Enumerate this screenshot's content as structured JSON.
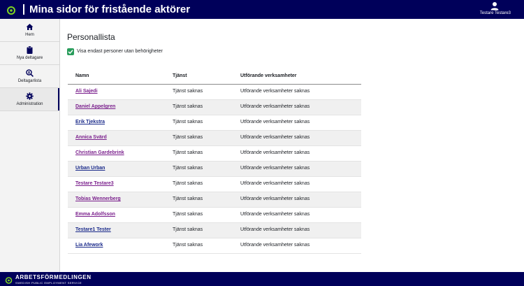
{
  "header": {
    "title": "Mina sidor för fristående aktörer",
    "user_name": "Testare Testare3"
  },
  "sidebar": {
    "items": [
      {
        "label": "Hem",
        "icon": "home-icon"
      },
      {
        "label": "Nya deltagare",
        "icon": "clipboard-icon"
      },
      {
        "label": "Deltagarlista",
        "icon": "search-person-icon"
      },
      {
        "label": "Administration",
        "icon": "gear-icon",
        "active": true
      }
    ]
  },
  "main": {
    "title": "Personallista",
    "filter_checkbox": {
      "label": "Visa endast personer utan behörigheter",
      "checked": true
    },
    "table": {
      "columns": [
        "Namn",
        "Tjänst",
        "Utförande verksamheter"
      ],
      "rows": [
        {
          "name": "Ali Sajedi",
          "service": "Tjänst saknas",
          "operations": "Utförande verksamheter saknas"
        },
        {
          "name": "Daniel Appelgren",
          "service": "Tjänst saknas",
          "operations": "Utförande verksamheter saknas"
        },
        {
          "name": "Erik Tjekstra",
          "service": "Tjänst saknas",
          "operations": "Utförande verksamheter saknas"
        },
        {
          "name": "Annica Svärd",
          "service": "Tjänst saknas",
          "operations": "Utförande verksamheter saknas"
        },
        {
          "name": "Christian Gardebrink",
          "service": "Tjänst saknas",
          "operations": "Utförande verksamheter saknas"
        },
        {
          "name": "Urban Urban",
          "service": "Tjänst saknas",
          "operations": "Utförande verksamheter saknas"
        },
        {
          "name": "Testare Testare3",
          "service": "Tjänst saknas",
          "operations": "Utförande verksamheter saknas"
        },
        {
          "name": "Tobias Wennerberg",
          "service": "Tjänst saknas",
          "operations": "Utförande verksamheter saknas"
        },
        {
          "name": "Emma Adolfsson",
          "service": "Tjänst saknas",
          "operations": "Utförande verksamheter saknas"
        },
        {
          "name": "Testare1 Tester",
          "service": "Tjänst saknas",
          "operations": "Utförande verksamheter saknas"
        },
        {
          "name": "Lia Afework",
          "service": "Tjänst saknas",
          "operations": "Utförande verksamheter saknas"
        }
      ]
    }
  },
  "footer": {
    "brand": "ARBETSFÖRMEDLINGEN",
    "subtitle": "SWEDISH PUBLIC EMPLOYMENT SERVICE"
  },
  "colors": {
    "header_bg": "#00005a",
    "link_blue": "#1a2a8a",
    "link_visited": "#7a1f8c",
    "checkbox": "#2a9d5c"
  }
}
